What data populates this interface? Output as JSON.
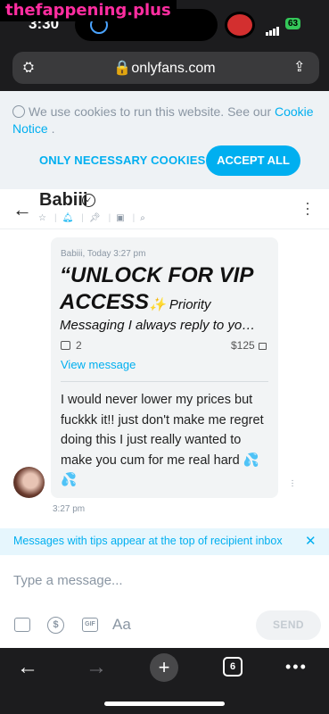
{
  "watermark": "thefappening.plus",
  "status_bar": {
    "time": "3:30",
    "battery": "63"
  },
  "browser": {
    "url": "onlyfans.com",
    "tab_count": "6"
  },
  "cookie_banner": {
    "text": "We use cookies to run this website. See our ",
    "link": "Cookie Notice",
    "suffix": " .",
    "necessary_label": "ONLY NECESSARY COOKIES",
    "accept_label": "ACCEPT ALL"
  },
  "chat_header": {
    "name": "Babiii"
  },
  "message": {
    "meta": "Babiii, Today 3:27 pm",
    "title": "“UNLOCK FOR VIP ACCESS",
    "title_tail": "✨ Priority",
    "line2": "Messaging I always reply to you…",
    "media_count": "2",
    "price": "$125",
    "view_label": "View message",
    "body": "I would never lower my prices but fuckkk it!! just don't make me regret doing this I just really wanted to make you cum for me real hard 💦💦",
    "time": "3:27 pm"
  },
  "tips_banner": {
    "text": "Messages with tips appear at the top of recipient inbox"
  },
  "composer": {
    "placeholder": "Type a message...",
    "text_tool": "Aa",
    "send_label": "SEND"
  },
  "colors": {
    "accent": "#00aff0",
    "muted": "#8a96a3"
  }
}
